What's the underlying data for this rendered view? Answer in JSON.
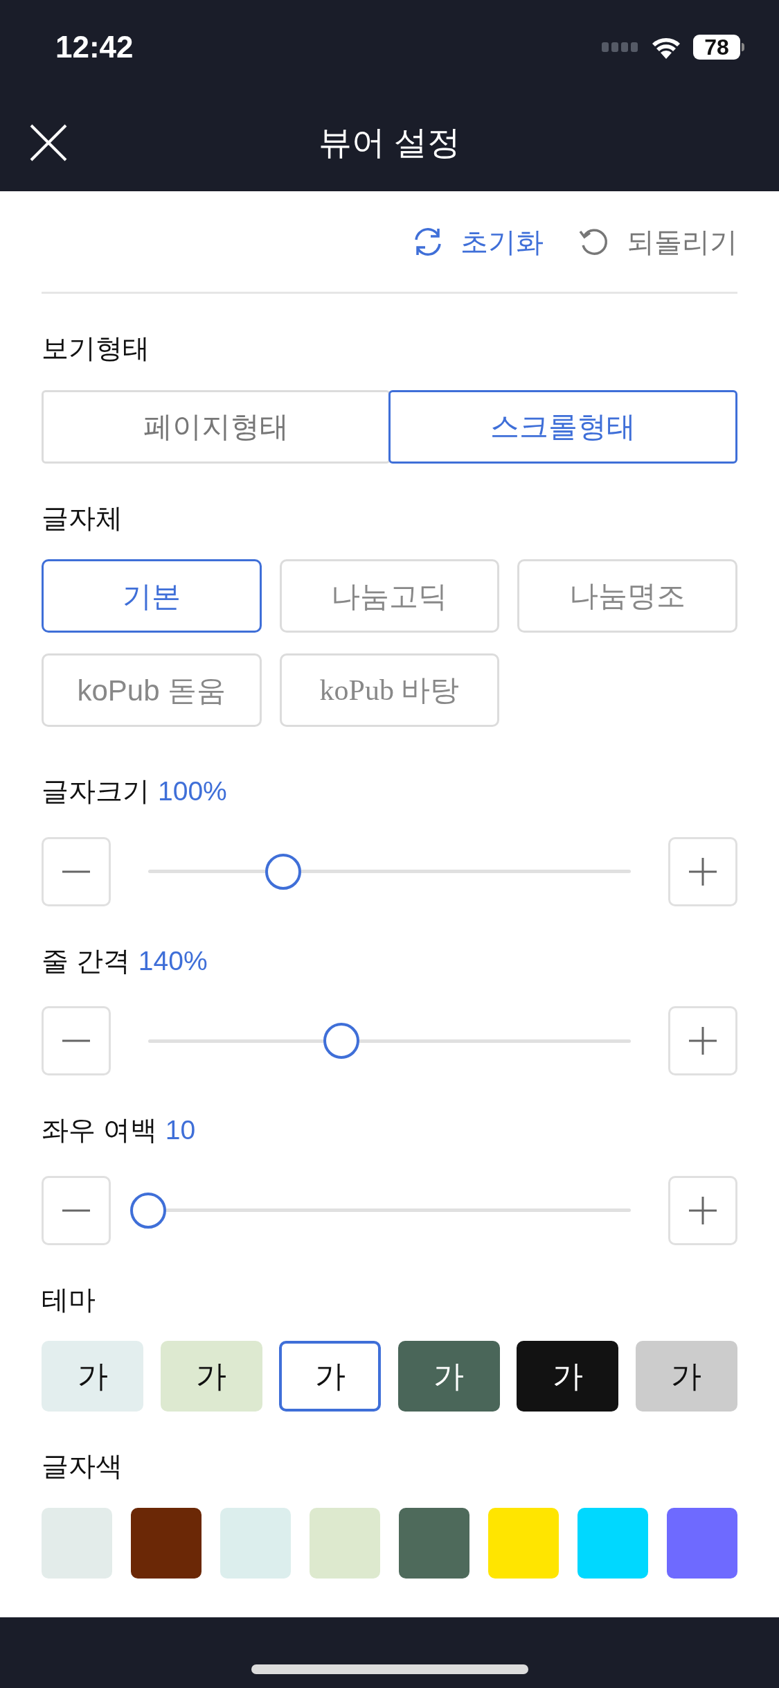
{
  "status_bar": {
    "time": "12:42",
    "battery": "78"
  },
  "header": {
    "title": "뷰어 설정"
  },
  "actions": [
    {
      "kind": "reset",
      "label": "초기화",
      "disabled": false
    },
    {
      "kind": "undo",
      "label": "되돌리기",
      "disabled": true
    }
  ],
  "view_mode": {
    "label": "보기형태",
    "options": [
      {
        "label": "페이지형태",
        "selected": false
      },
      {
        "label": "스크롤형태",
        "selected": true
      }
    ]
  },
  "font": {
    "label": "글자체",
    "options": [
      {
        "label": "기본",
        "kind": "sans",
        "selected": true
      },
      {
        "label": "나눔고딕",
        "kind": "sans",
        "selected": false
      },
      {
        "label": "나눔명조",
        "kind": "serif",
        "selected": false
      },
      {
        "label": "koPub 돋움",
        "kind": "sans",
        "selected": false
      },
      {
        "label": "koPub 바탕",
        "kind": "serif",
        "selected": false
      }
    ]
  },
  "sliders": [
    {
      "label": "글자크기",
      "value": "100%",
      "level": 0.28
    },
    {
      "label": "줄 간격",
      "value": "140%",
      "level": 0.4
    },
    {
      "label": "좌우 여백",
      "value": "10",
      "level": 0
    }
  ],
  "theme": {
    "label": "테마",
    "options": [
      {
        "label": "가",
        "color": "#e3eeee",
        "selected": false
      },
      {
        "label": "가",
        "color": "#dde9d0",
        "selected": false
      },
      {
        "label": "가",
        "color": "#ffffff",
        "selected": true
      },
      {
        "label": "가",
        "color": "#4a6659",
        "selected": false
      },
      {
        "label": "가",
        "color": "#121212",
        "selected": false
      },
      {
        "label": "가",
        "color": "#cccccc",
        "selected": false
      }
    ]
  },
  "text_color": {
    "label": "글자색",
    "options": [
      {
        "color": "#e3ecea"
      },
      {
        "color": "#6b2806"
      },
      {
        "color": "#dceeed"
      },
      {
        "color": "#dde9ce"
      },
      {
        "color": "#4e6a5b"
      },
      {
        "color": "#ffe500"
      },
      {
        "color": "#00d8ff"
      },
      {
        "color": "#6e6aff"
      }
    ]
  }
}
